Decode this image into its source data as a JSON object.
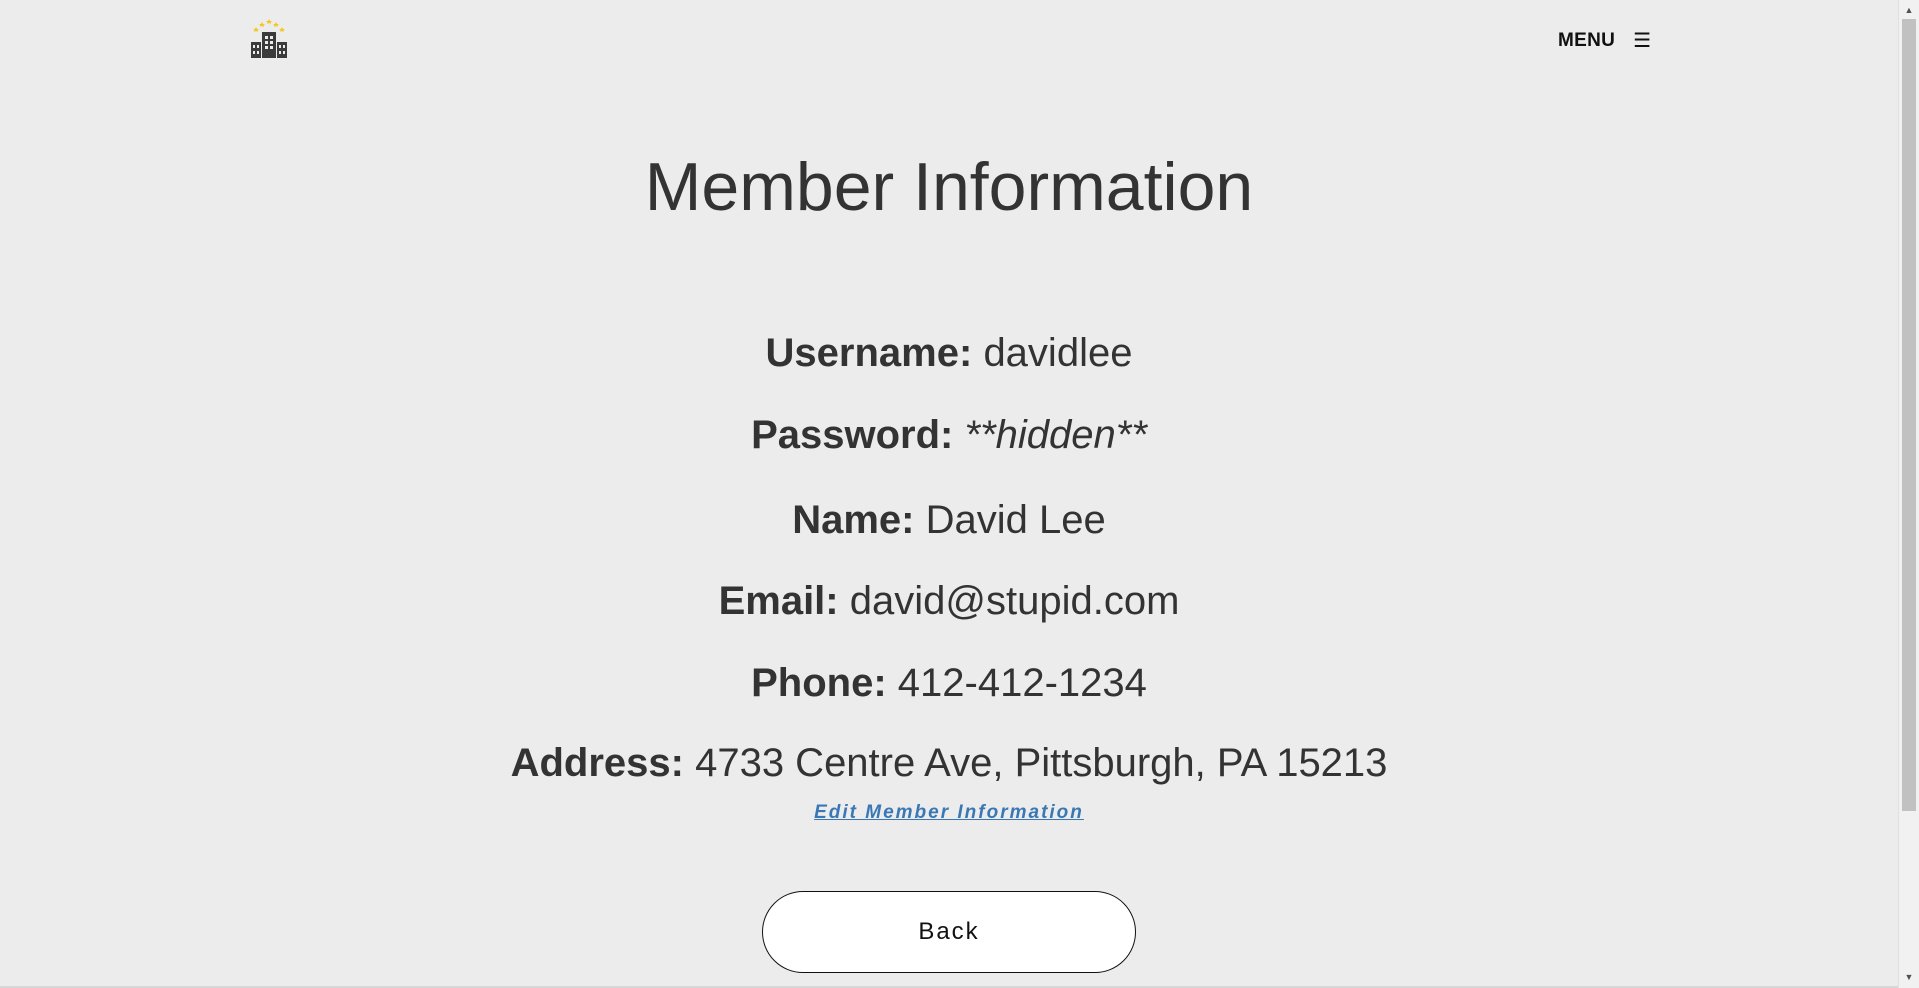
{
  "header": {
    "logo_icon": "hotel-building-stars-icon",
    "menu_label": "MENU",
    "menu_icon": "hamburger-icon"
  },
  "main": {
    "title": "Member Information",
    "fields": {
      "username": {
        "label": "Username:",
        "value": "davidlee"
      },
      "password": {
        "label": "Password:",
        "value": "**hidden**"
      },
      "name": {
        "label": "Name:",
        "value": "David Lee"
      },
      "email": {
        "label": "Email:",
        "value": "david@stupid.com"
      },
      "phone": {
        "label": "Phone:",
        "value": "412-412-1234"
      },
      "address": {
        "label": "Address:",
        "value": "4733 Centre Ave, Pittsburgh, PA 15213"
      }
    },
    "edit_link": "Edit Member Information",
    "back_button": "Back"
  },
  "colors": {
    "background": "#ececec",
    "text": "#333333",
    "link": "#3a78b5",
    "logo_star": "#f2c81a"
  }
}
